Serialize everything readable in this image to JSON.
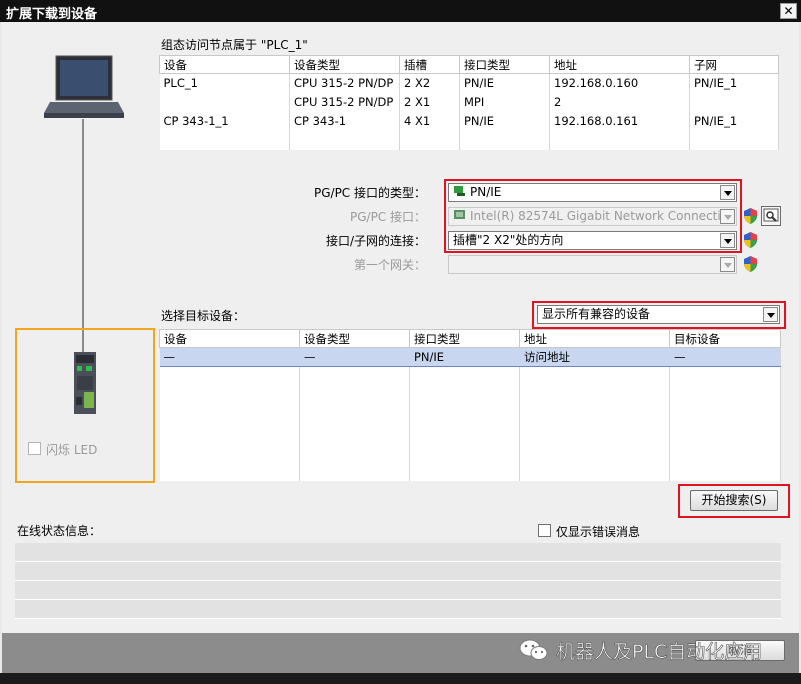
{
  "window": {
    "title": "扩展下载到设备",
    "close_glyph": "✕"
  },
  "config": {
    "caption": "组态访问节点属于 \"PLC_1\"",
    "headers": [
      "设备",
      "设备类型",
      "插槽",
      "接口类型",
      "地址",
      "子网"
    ],
    "rows": [
      [
        "PLC_1",
        "CPU 315-2 PN/DP",
        "2 X2",
        "PN/IE",
        "192.168.0.160",
        "PN/IE_1"
      ],
      [
        "",
        "CPU 315-2 PN/DP",
        "2 X1",
        "MPI",
        "2",
        ""
      ],
      [
        "CP 343-1_1",
        "CP 343-1",
        "4 X1",
        "PN/IE",
        "192.168.0.161",
        "PN/IE_1"
      ],
      [
        "",
        "",
        "",
        "",
        "",
        ""
      ]
    ]
  },
  "pgpc": {
    "type_label": "PG/PC 接口的类型：",
    "type_value": "PN/IE",
    "iface_label": "PG/PC 接口：",
    "iface_value": "Intel(R) 82574L Gigabit Network Connection",
    "conn_label": "接口/子网的连接：",
    "conn_value": "插槽\"2 X2\"处的方向",
    "gateway_label": "第一个网关：",
    "gateway_value": ""
  },
  "target": {
    "label": "选择目标设备：",
    "filter_value": "显示所有兼容的设备",
    "headers": [
      "设备",
      "设备类型",
      "接口类型",
      "地址",
      "目标设备"
    ],
    "rows": [
      [
        "—",
        "—",
        "PN/IE",
        "访问地址",
        "—"
      ],
      [
        "",
        "",
        "",
        "",
        ""
      ],
      [
        "",
        "",
        "",
        "",
        ""
      ],
      [
        "",
        "",
        "",
        "",
        ""
      ],
      [
        "",
        "",
        "",
        "",
        ""
      ],
      [
        "",
        "",
        "",
        "",
        ""
      ],
      [
        "",
        "",
        "",
        "",
        ""
      ]
    ]
  },
  "flash_led_label": "闪烁 LED",
  "search_button": "开始搜索(S)",
  "status": {
    "label": "在线状态信息：",
    "errors_only_label": "仅显示错误消息"
  },
  "bottom": {
    "watermark": "机器人及PLC自动化应用",
    "partial_button": "取消"
  },
  "colors": {
    "highlight_red": "#e0141e",
    "highlight_orange": "#f2a51f",
    "selected_row": "#c8d6ef"
  },
  "icons": [
    "laptop-icon",
    "plc-device-icon",
    "network-adapter-icon",
    "shield-icon",
    "diagnostics-icon",
    "wechat-icon"
  ]
}
